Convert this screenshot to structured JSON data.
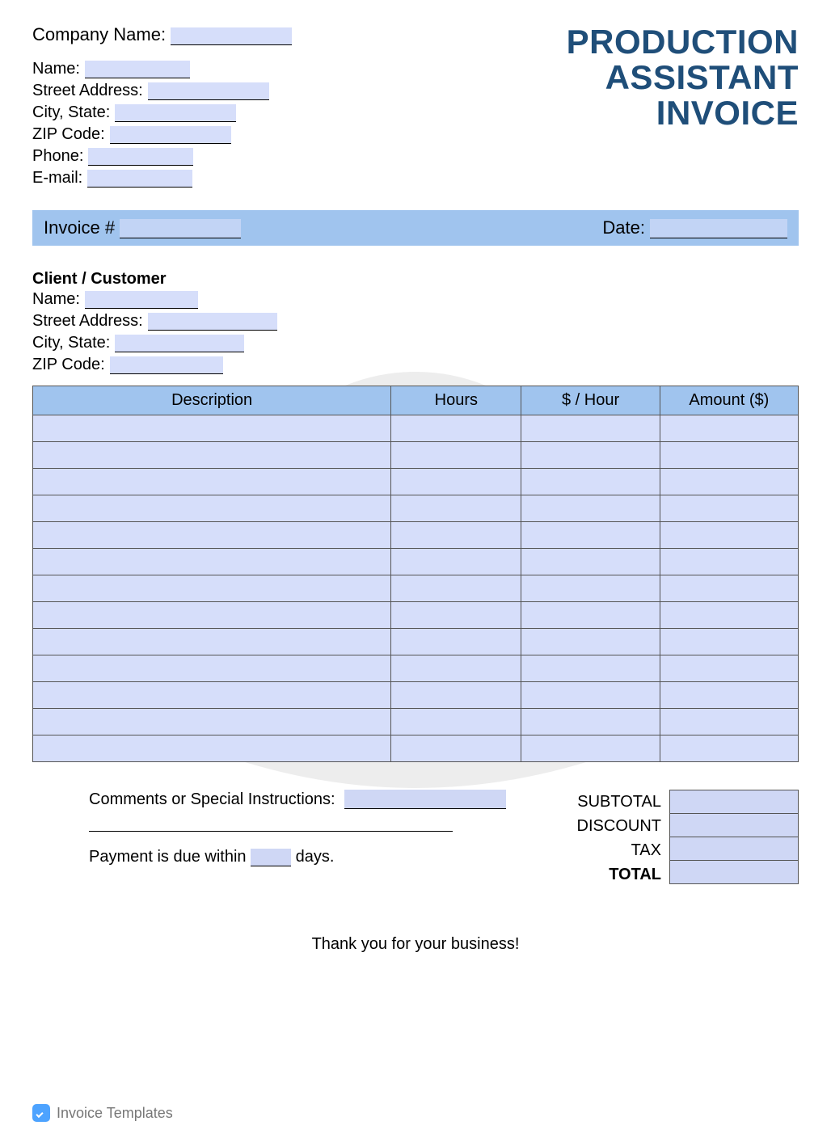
{
  "title": {
    "line1": "PRODUCTION",
    "line2": "ASSISTANT",
    "line3": "INVOICE"
  },
  "company": {
    "company_name_label": "Company Name:",
    "name_label": "Name:",
    "street_label": "Street Address:",
    "city_state_label": "City, State:",
    "zip_label": "ZIP Code:",
    "phone_label": "Phone:",
    "email_label": "E-mail:"
  },
  "invoice_bar": {
    "invoice_number_label": "Invoice #",
    "date_label": "Date:"
  },
  "client": {
    "heading": "Client / Customer",
    "name_label": "Name:",
    "street_label": "Street Address:",
    "city_state_label": "City, State:",
    "zip_label": "ZIP Code:"
  },
  "table": {
    "headers": {
      "description": "Description",
      "hours": "Hours",
      "rate": "$ / Hour",
      "amount": "Amount ($)"
    },
    "row_count": 13
  },
  "bottom": {
    "comments_label": "Comments or Special Instructions:",
    "payment_prefix": "Payment is due within ",
    "payment_suffix": " days.",
    "subtotal_label": "SUBTOTAL",
    "discount_label": "DISCOUNT",
    "tax_label": "TAX",
    "total_label": "TOTAL"
  },
  "thank_you": "Thank you for your business!",
  "footer": {
    "brand": "Invoice Templates"
  }
}
